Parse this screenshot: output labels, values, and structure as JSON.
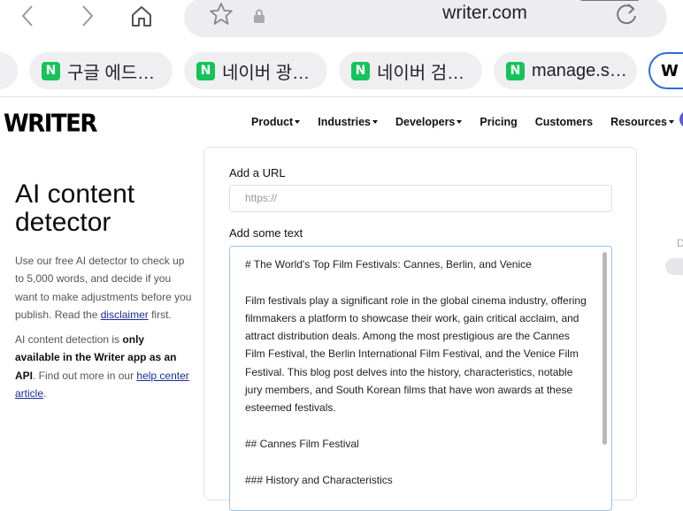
{
  "browser": {
    "url": "writer.com",
    "tabs": [
      {
        "label": "구글 에드…",
        "favicon": "N"
      },
      {
        "label": "네이버 광…",
        "favicon": "N"
      },
      {
        "label": "네이버 검…",
        "favicon": "N"
      },
      {
        "label": "manage.s…",
        "favicon": "N"
      }
    ],
    "active_tab_logo": "W"
  },
  "site": {
    "brand": "WRITER",
    "menu": [
      {
        "label": "Product",
        "has_dropdown": true
      },
      {
        "label": "Industries",
        "has_dropdown": true
      },
      {
        "label": "Developers",
        "has_dropdown": true
      },
      {
        "label": "Pricing",
        "has_dropdown": false
      },
      {
        "label": "Customers",
        "has_dropdown": false
      },
      {
        "label": "Resources",
        "has_dropdown": true
      }
    ]
  },
  "hero": {
    "title": "AI content detector",
    "desc_1": "Use our free AI detector to check up to 5,000 words, and decide if you want to make adjustments before you publish. Read the ",
    "desc_1_link": "disclaimer",
    "desc_1_tail": " first.",
    "desc_2_a": "AI content detection is ",
    "desc_2_bold": "only available in the Writer app as an API",
    "desc_2_b": ". Find out more in our ",
    "desc_2_link": "help center article",
    "desc_2_tail": "."
  },
  "form": {
    "url_label": "Add a URL",
    "url_placeholder": "https://",
    "text_label": "Add some text",
    "text_value": "# The World's Top Film Festivals: Cannes, Berlin, and Venice\n\nFilm festivals play a significant role in the global cinema industry, offering filmmakers a platform to showcase their work, gain critical acclaim, and attract distribution deals. Among the most prestigious are the Cannes Film Festival, the Berlin International Film Festival, and the Venice Film Festival. This blog post delves into the history, characteristics, notable jury members, and South Korean films that have won awards at these esteemed festivals.\n\n## Cannes Film Festival\n\n### History and Characteristics"
  },
  "right_panel": {
    "partial_letter": "D"
  },
  "colors": {
    "naver_green": "#14c35a",
    "active_tab_border": "#2b6fd6",
    "link": "#1b2b9a",
    "textarea_focus": "#9bc4e6"
  }
}
